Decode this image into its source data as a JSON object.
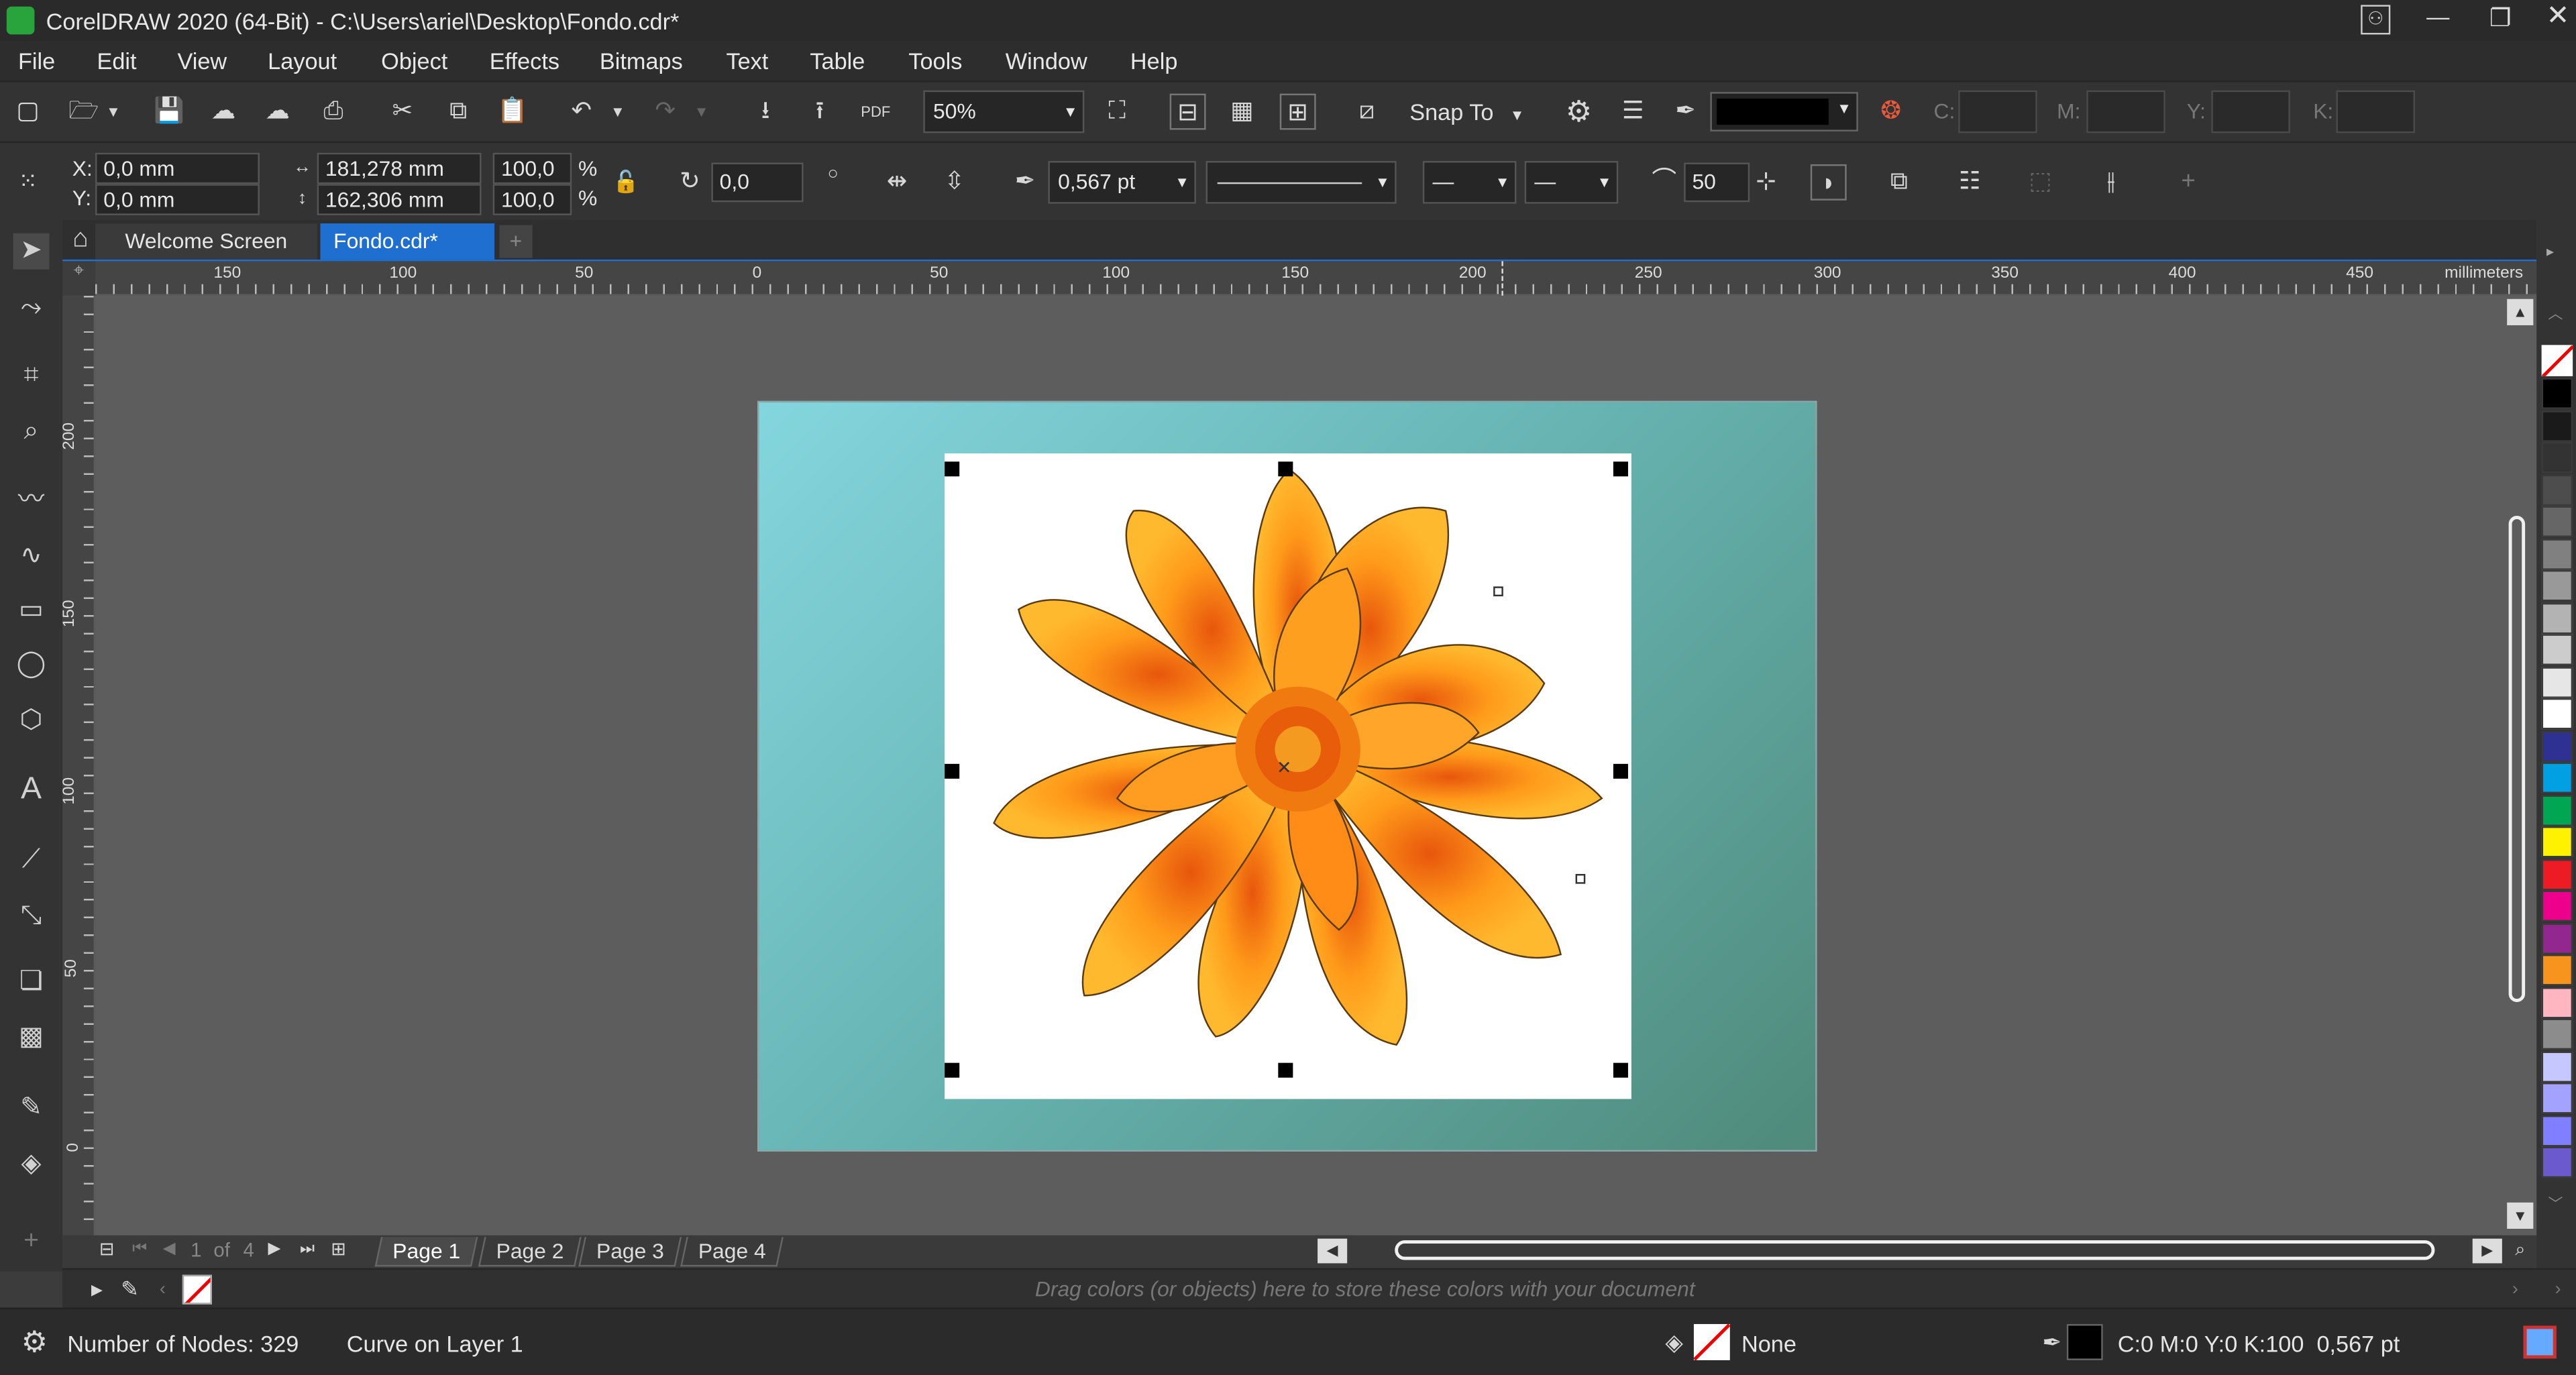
{
  "window": {
    "title": "CorelDRAW 2020 (64-Bit) - C:\\Users\\ariel\\Desktop\\Fondo.cdr*",
    "app_icon": "coreldraw-logo"
  },
  "menu": [
    "File",
    "Edit",
    "View",
    "Layout",
    "Object",
    "Effects",
    "Bitmaps",
    "Text",
    "Table",
    "Tools",
    "Window",
    "Help"
  ],
  "toolbar": {
    "zoom_value": "50%",
    "snap_label": "Snap To",
    "outline_color": "#000000",
    "cmyk_labels": [
      "C:",
      "M:",
      "Y:",
      "K:"
    ]
  },
  "property_bar": {
    "x_label": "X:",
    "x_value": "0,0 mm",
    "y_label": "Y:",
    "y_value": "0,0 mm",
    "width_value": "181,278 mm",
    "height_value": "162,306 mm",
    "scale_x": "100,0",
    "scale_y": "100,0",
    "pct": "%",
    "rotation": "0,0",
    "outline_width": "0,567 pt",
    "smoothing": "50"
  },
  "tabs": {
    "welcome": "Welcome Screen",
    "document": "Fondo.cdr*"
  },
  "ruler": {
    "h_labels": [
      "150",
      "100",
      "50",
      "0",
      "50",
      "100",
      "150",
      "200",
      "250",
      "300",
      "350",
      "400",
      "450"
    ],
    "unit": "millimeters",
    "v_labels": [
      "200",
      "150",
      "100",
      "50",
      "0"
    ]
  },
  "pages": {
    "counter_current": "1",
    "counter_of": "of",
    "counter_total": "4",
    "tabs": [
      "Page 1",
      "Page 2",
      "Page 3",
      "Page 4"
    ]
  },
  "document_palette": {
    "hint": "Drag colors (or objects) here to store these colors with your document"
  },
  "status": {
    "nodes": "Number of Nodes: 329",
    "object_info": "Curve on Layer 1",
    "fill": "None",
    "outline": "C:0 M:0 Y:0 K:100  0,567 pt"
  },
  "colors": {
    "accent_tab": "#1f6fd1",
    "background_gradient_start": "#84d6de",
    "background_gradient_end": "#4f8a7a",
    "petal_light": "#ffb92e",
    "petal_dark": "#e8560c"
  },
  "palette_colors": [
    "#000000",
    "#1a1a1a",
    "#333333",
    "#4d4d4d",
    "#666666",
    "#808080",
    "#999999",
    "#b3b3b3",
    "#cccccc",
    "#e6e6e6",
    "#ffffff",
    "#2e3192",
    "#00a0e3",
    "#00a651",
    "#fff200",
    "#ed1c24",
    "#ec008c",
    "#92278f",
    "#f7941d",
    "#ffb6c1",
    "#8c8c8c",
    "#c7c7ff",
    "#a3a3ff",
    "#7f7fff",
    "#6a5acd"
  ]
}
